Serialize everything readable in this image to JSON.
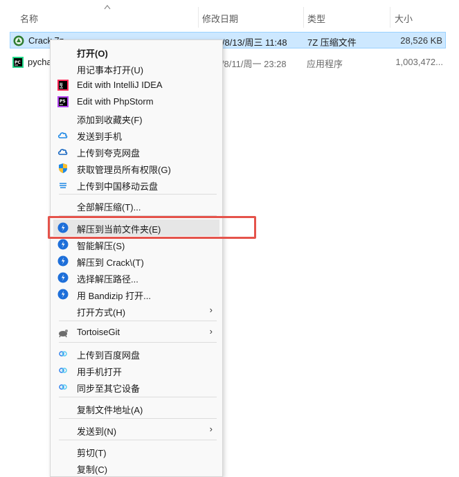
{
  "columns": {
    "name": "名称",
    "date": "修改日期",
    "type": "类型",
    "size": "大小"
  },
  "files": [
    {
      "name": "Crack.7z",
      "date": "2025/8/13/周三 11:48",
      "type": "7Z 压缩文件",
      "size": "28,526 KB",
      "selected": true
    },
    {
      "name": "pycharm",
      "date": "2025/8/11/周一 23:28",
      "type": "应用程序",
      "size": "1,003,472...",
      "selected": false
    }
  ],
  "menu": {
    "open": "打开(O)",
    "open_notepad": "用记事本打开(U)",
    "edit_idea": "Edit with IntelliJ IDEA",
    "edit_phpstorm": "Edit with PhpStorm",
    "add_favorites": "添加到收藏夹(F)",
    "send_phone": "发送到手机",
    "upload_quark": "上传到夸克网盘",
    "admin": "获取管理员所有权限(G)",
    "upload_cmcc": "上传到中国移动云盘",
    "extract_all": "全部解压缩(T)...",
    "extract_here": "解压到当前文件夹(E)",
    "smart_extract": "智能解压(S)",
    "extract_to": "解压到 Crack\\(T)",
    "choose_path": "选择解压路径...",
    "open_bandizip": "用 Bandizip 打开...",
    "open_with": "打开方式(H)",
    "tortoise": "TortoiseGit",
    "upload_baidu": "上传到百度网盘",
    "open_phone": "用手机打开",
    "sync_devices": "同步至其它设备",
    "copy_path": "复制文件地址(A)",
    "send_to": "发送到(N)",
    "cut": "剪切(T)",
    "copy": "复制(C)"
  },
  "icons": {
    "archive": "7z-archive-icon",
    "app": "pycharm-icon",
    "idea": "intellij-icon",
    "phpstorm": "phpstorm-icon",
    "cloud": "cloud-icon",
    "shield": "shield-icon",
    "bandizip": "bandizip-icon",
    "tortoise": "tortoisegit-icon",
    "baidu": "baidu-cloud-icon"
  },
  "colors": {
    "selection": "#cde8ff",
    "highlight": "#e5534b",
    "bandizip": "#1e6fd9"
  }
}
